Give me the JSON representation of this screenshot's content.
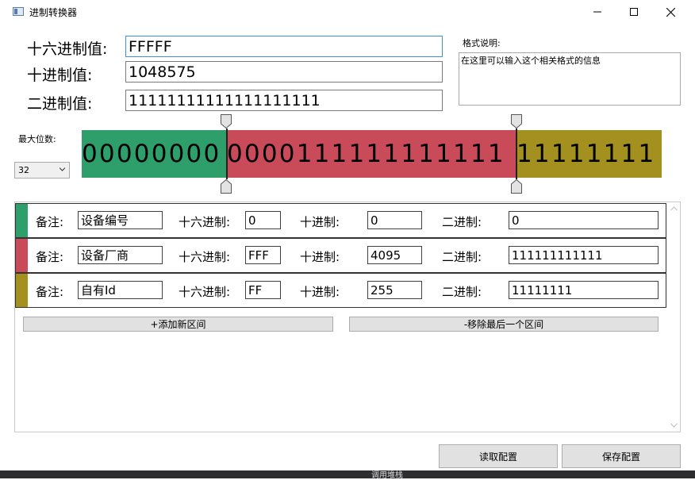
{
  "window": {
    "title": "进制转换器"
  },
  "fields": {
    "hex_label": "十六进制值:",
    "hex_value": "FFFFF",
    "dec_label": "十进制值:",
    "dec_value": "1048575",
    "bin_label": "二进制值:",
    "bin_value": "11111111111111111111"
  },
  "format_note": {
    "label": "格式说明:",
    "text": "在这里可以输入这个相关格式的信息"
  },
  "max_bits": {
    "label": "最大位数:",
    "value": "32"
  },
  "bit_segments": [
    {
      "bits": "00000000",
      "color": "#2e9e6b"
    },
    {
      "bits": "0000111111111111",
      "color": "#c94b5a"
    },
    {
      "bits": "11111111",
      "color": "#a3901f"
    }
  ],
  "row_labels": {
    "note": "备注:",
    "hex": "十六进制:",
    "dec": "十进制:",
    "bin": "二进制:"
  },
  "intervals": [
    {
      "color": "#2e9e6b",
      "note": "设备编号",
      "hex": "0",
      "dec": "0",
      "bin": "0"
    },
    {
      "color": "#c94b5a",
      "note": "设备厂商",
      "hex": "FFF",
      "dec": "4095",
      "bin": "111111111111"
    },
    {
      "color": "#a3901f",
      "note": "自有Id",
      "hex": "FF",
      "dec": "255",
      "bin": "11111111"
    }
  ],
  "buttons": {
    "add_interval": "+添加新区间",
    "remove_last": "-移除最后一个区间",
    "read_config": "读取配置",
    "save_config": "保存配置"
  },
  "taskbar_text": "调用堆栈",
  "icons": [
    "app-icon",
    "minimize-icon",
    "maximize-icon",
    "close-icon",
    "chevron-down-icon",
    "scroll-up-icon",
    "scroll-down-icon"
  ]
}
